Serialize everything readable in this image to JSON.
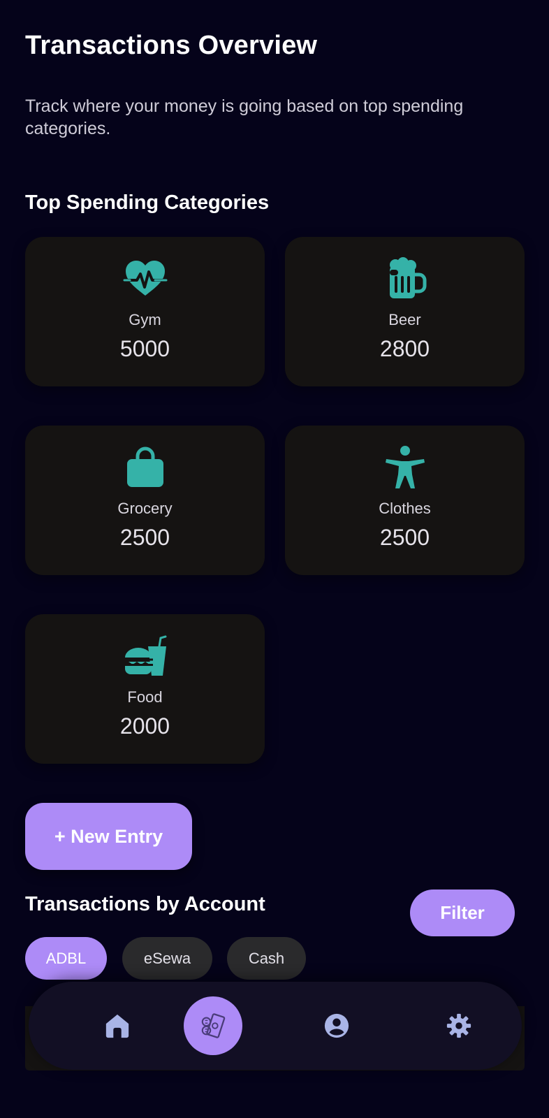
{
  "header": {
    "title": "Transactions Overview",
    "subtitle": "Track where your money is going based on top spending categories."
  },
  "top_categories": {
    "title": "Top Spending Categories",
    "items": [
      {
        "label": "Gym",
        "value": "5000",
        "icon": "heartbeat-icon"
      },
      {
        "label": "Beer",
        "value": "2800",
        "icon": "beer-mug-icon"
      },
      {
        "label": "Grocery",
        "value": "2500",
        "icon": "shopping-bag-icon"
      },
      {
        "label": "Clothes",
        "value": "2500",
        "icon": "person-icon"
      },
      {
        "label": "Food",
        "value": "2000",
        "icon": "burger-drink-icon"
      }
    ]
  },
  "actions": {
    "new_entry_label": "+ New Entry",
    "filter_label": "Filter"
  },
  "accounts": {
    "title": "Transactions by Account",
    "chips": [
      {
        "label": "ADBL",
        "active": true
      },
      {
        "label": "eSewa",
        "active": false
      },
      {
        "label": "Cash",
        "active": false
      }
    ]
  },
  "bottom_nav": {
    "items": [
      {
        "name": "home",
        "icon": "home-icon",
        "active": false
      },
      {
        "name": "transactions",
        "icon": "money-transfer-icon",
        "active": true
      },
      {
        "name": "profile",
        "icon": "user-circle-icon",
        "active": false
      },
      {
        "name": "settings",
        "icon": "gear-icon",
        "active": false
      }
    ]
  },
  "colors": {
    "background": "#05031a",
    "card": "#151312",
    "accent": "#ad8bf7",
    "icon_teal": "#35b2a8",
    "nav_icon": "#a9b4e6"
  }
}
